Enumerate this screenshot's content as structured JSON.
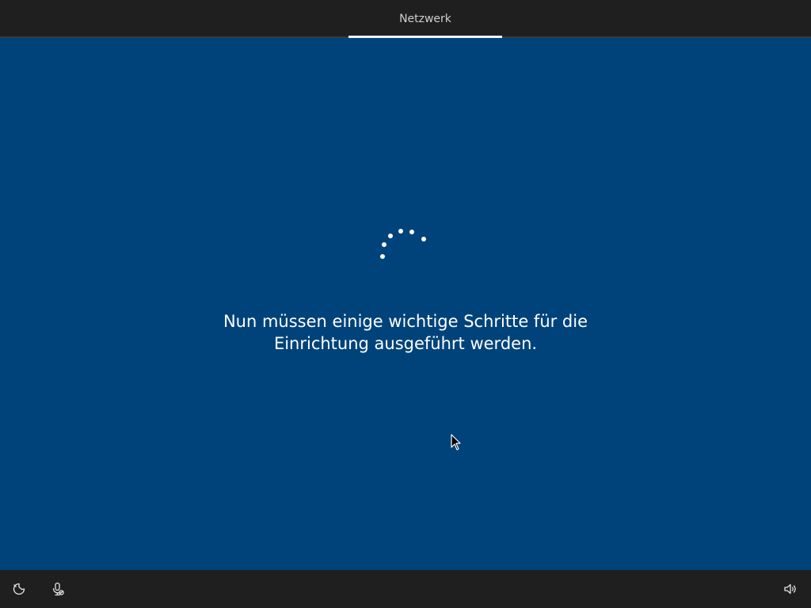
{
  "header": {
    "tabs": [
      {
        "label": "Netzwerk",
        "active": true
      }
    ]
  },
  "main": {
    "message_line1": "Nun müssen einige wichtige Schritte für die",
    "message_line2": "Einrichtung ausgeführt werden."
  },
  "footer": {
    "left_icons": [
      "ease-of-access-icon",
      "microphone-icon"
    ],
    "right_icons": [
      "volume-icon"
    ]
  },
  "colors": {
    "background": "#00437a",
    "bar": "#1f1f1f",
    "text": "#ffffff",
    "tab_text": "#cfcfcf"
  }
}
